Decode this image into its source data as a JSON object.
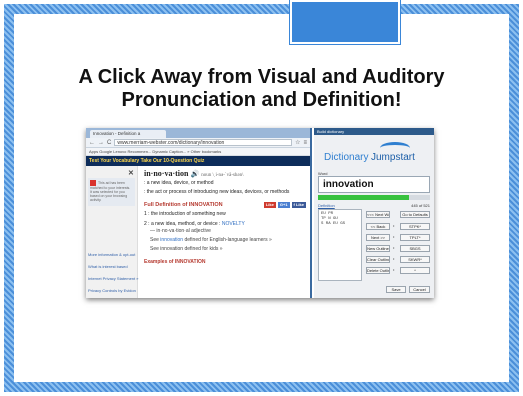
{
  "slide": {
    "title_line1": "A Click Away from Visual and Auditory",
    "title_line2": "Pronunciation and Definition!"
  },
  "browser": {
    "tab_title": "Innovation - Definition a",
    "url": "www.merriam-webster.com/dictionary/innovation",
    "bookmarks": "Apps  Google  Lenovo Recommen...  Dynamic Caption...   »  Other bookmarks",
    "banner": "Test Your Vocabulary  Take Our 10-Question Quiz",
    "close_glyph": "✕",
    "ad_text": "This ad has been matched to your interests. It was selected for you based on your browsing activity.",
    "side_links": [
      "More information & opt-out",
      "What is interest based",
      "Internet Privacy Statement »",
      "Privacy Controls by Evidon"
    ],
    "headword": "in·no·va·tion",
    "pron": "noun  \\ˌi-nə-ˈvā-shən\\",
    "def1": ": a new idea, device, or method",
    "def2": ": the act or process of introducing new ideas, devices, or methods",
    "full_def_heading": "Full Definition of INNOVATION",
    "social": [
      "Like",
      "G+1",
      "f Like"
    ],
    "sense1": "1  : the introduction of something new",
    "sense2_a": "2  : a new idea, method, or device : ",
    "sense2_b": "NOVELTY",
    "sense2_sub": "— in·no·va·tion·al  adjective",
    "see_a": "See ",
    "see_kw": "innovation",
    "see_b": " defined for English-language learners »",
    "see_c": "See innovation defined for kids »",
    "examples": "Examples of INNOVATION"
  },
  "dictionary": {
    "titlebar": "Build dictionary",
    "logo_part1": "Dictionary",
    "logo_part2": "Jumpstart",
    "word_label": "Word",
    "word": "innovation",
    "progress": 0.81,
    "definition_label": "Definition",
    "count": "445 of 521",
    "definition_text": "EU PR\nTP N GU\nS RA EU GS",
    "buttons": {
      "next": "<<< Next Word",
      "defaults": "Go to Defaults",
      "back": "<< Back",
      "next2": "Next >>",
      "new_outline": "New Outline",
      "clear_outlines": "Clear Outlines",
      "delete_outline": "Delete Outline",
      "stpk": "STPK*",
      "tplt": "TPLT*",
      "sbgs": "SBGS",
      "skwr": "SKWR*",
      "star": "*",
      "save": "Save",
      "cancel": "Cancel"
    },
    "dot": "•"
  }
}
